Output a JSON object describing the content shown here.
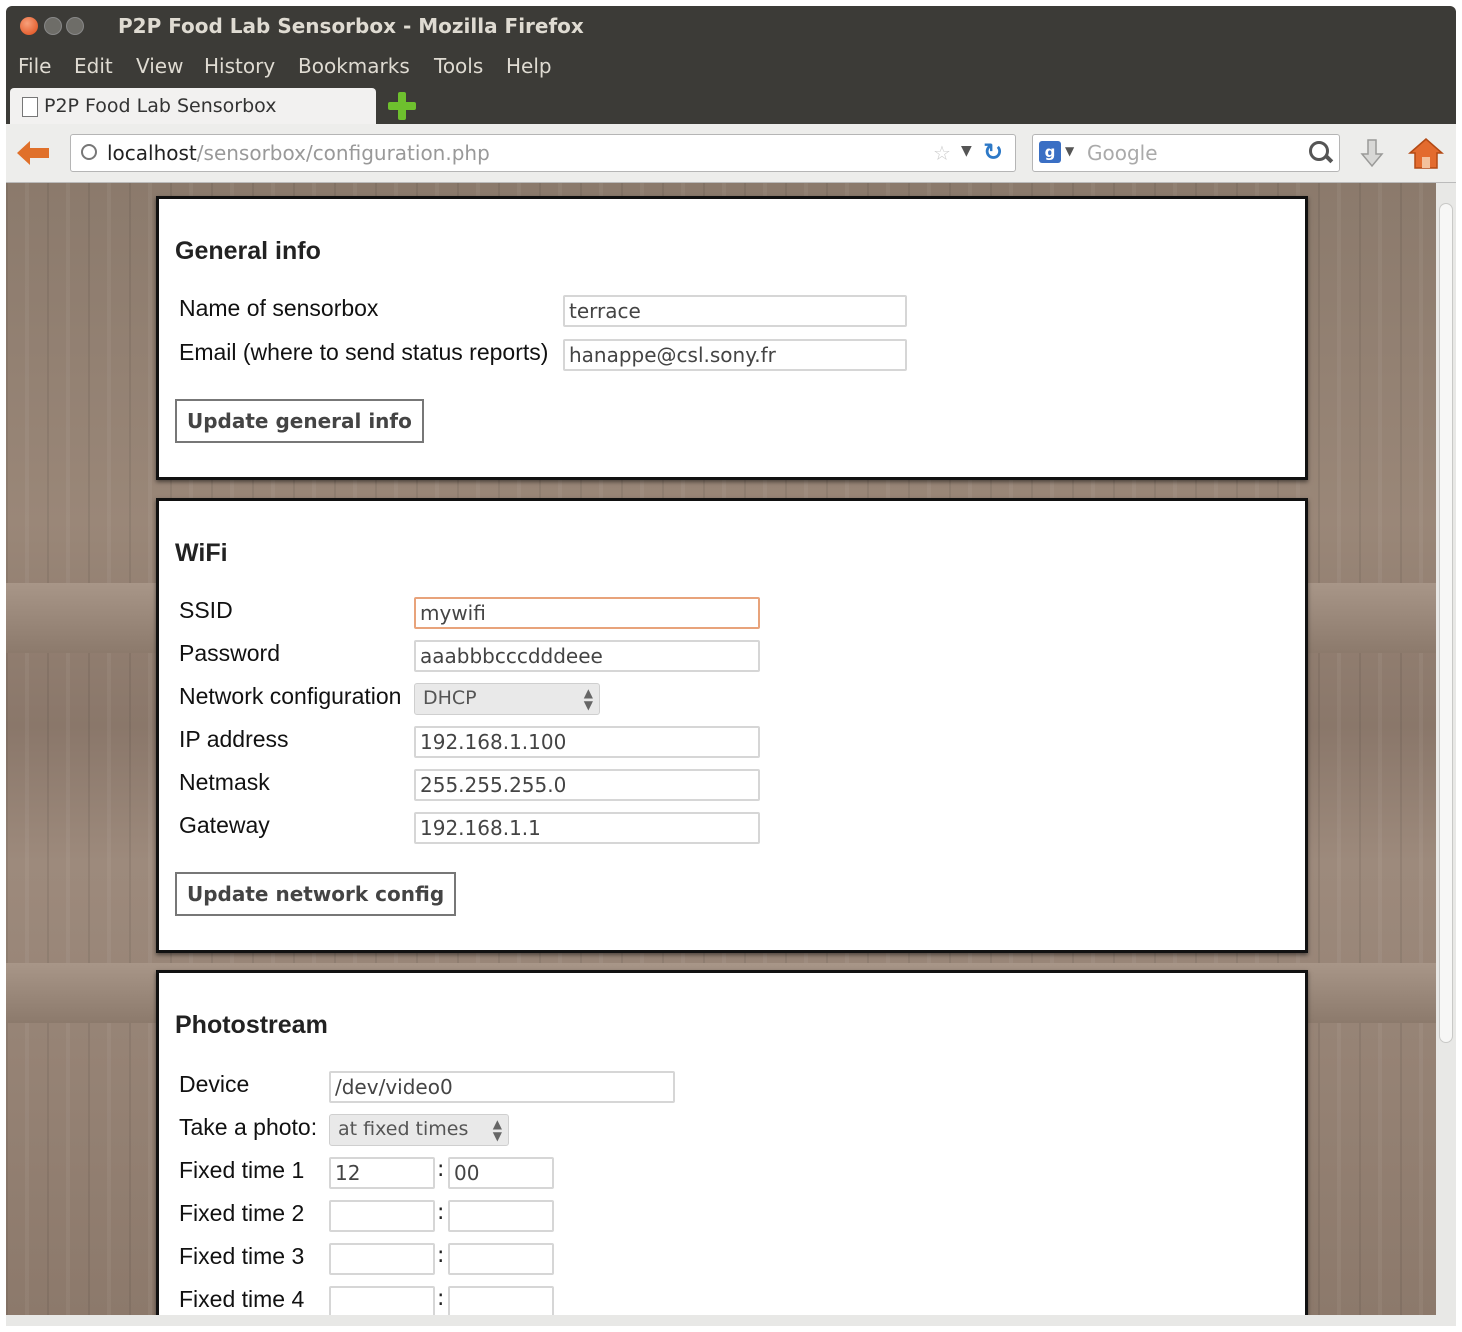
{
  "window": {
    "title": "P2P Food Lab Sensorbox - Mozilla Firefox"
  },
  "menu": [
    "File",
    "Edit",
    "View",
    "History",
    "Bookmarks",
    "Tools",
    "Help"
  ],
  "tab": {
    "label": "P2P Food Lab Sensorbox"
  },
  "address": {
    "host": "localhost",
    "path": "/sensorbox/configuration.php"
  },
  "search": {
    "placeholder": "Google"
  },
  "general": {
    "heading": "General info",
    "name_label": "Name of sensorbox",
    "name_value": "terrace",
    "email_label": "Email (where to send status reports)",
    "email_value": "hanappe@csl.sony.fr",
    "button": "Update general info"
  },
  "wifi": {
    "heading": "WiFi",
    "ssid_label": "SSID",
    "ssid_value": "mywifi",
    "password_label": "Password",
    "password_value": "aaabbbcccdddeee",
    "netconf_label": "Network configuration",
    "netconf_value": "DHCP",
    "ip_label": "IP address",
    "ip_value": "192.168.1.100",
    "netmask_label": "Netmask",
    "netmask_value": "255.255.255.0",
    "gateway_label": "Gateway",
    "gateway_value": "192.168.1.1",
    "button": "Update network config"
  },
  "photostream": {
    "heading": "Photostream",
    "device_label": "Device",
    "device_value": "/dev/video0",
    "take_label": "Take a photo:",
    "take_value": "at fixed times",
    "fixed_times": [
      {
        "label": "Fixed time 1",
        "hour": "12",
        "minute": "00"
      },
      {
        "label": "Fixed time 2",
        "hour": "",
        "minute": ""
      },
      {
        "label": "Fixed time 3",
        "hour": "",
        "minute": ""
      },
      {
        "label": "Fixed time 4",
        "hour": "",
        "minute": ""
      }
    ]
  }
}
